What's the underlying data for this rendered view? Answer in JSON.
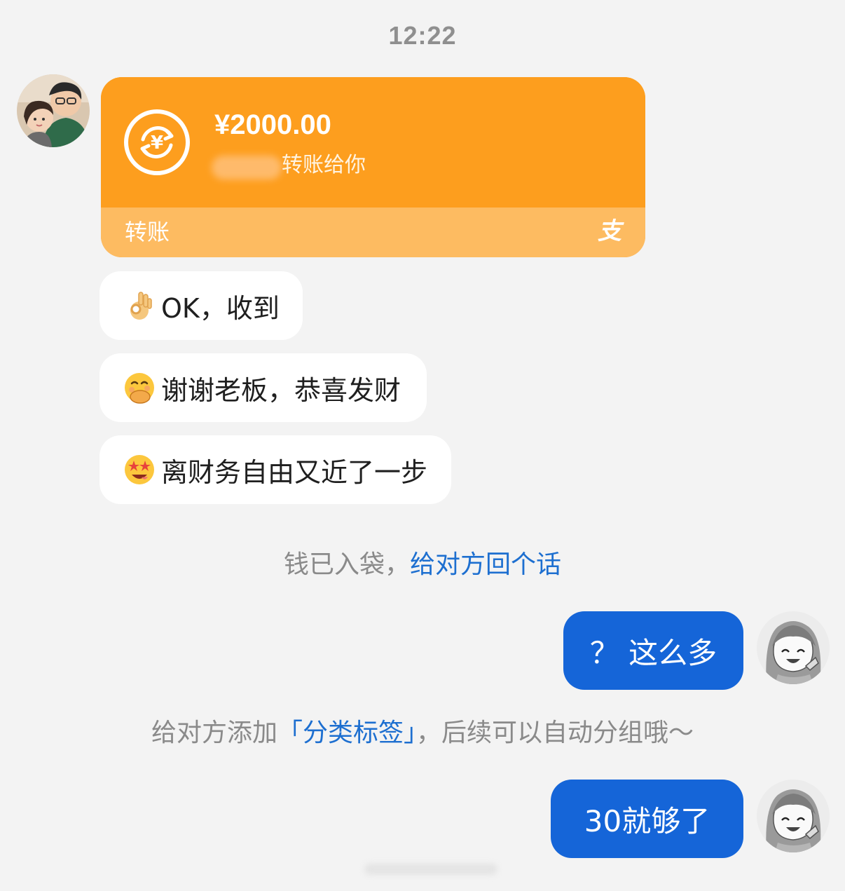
{
  "timestamp": "12:22",
  "transfer": {
    "amount": "¥2000.00",
    "description": "转账给你",
    "type_label": "转账",
    "provider_glyph": "支",
    "icon": "yuan-exchange-icon",
    "color": "#fd9e1e",
    "footer_color": "#fdbb61"
  },
  "messages_in": [
    {
      "emoji": "ok-hand-emoji",
      "text": "OK，收到"
    },
    {
      "emoji": "hand-over-mouth-emoji",
      "text": "谢谢老板，恭喜发财"
    },
    {
      "emoji": "star-struck-emoji",
      "text": "离财务自由又近了一步"
    }
  ],
  "notice_received": {
    "text": "钱已入袋，",
    "link": "给对方回个话"
  },
  "messages_out": [
    {
      "text": "？ 这么多"
    },
    {
      "text": "30就够了"
    }
  ],
  "notice_tag": {
    "prefix": "给对方添加",
    "link": "「分类标签」",
    "suffix": "，后续可以自动分组哦～"
  },
  "colors": {
    "background": "#f3f3f3",
    "outgoing_bubble": "#1565d8",
    "link": "#1d6fd0"
  }
}
